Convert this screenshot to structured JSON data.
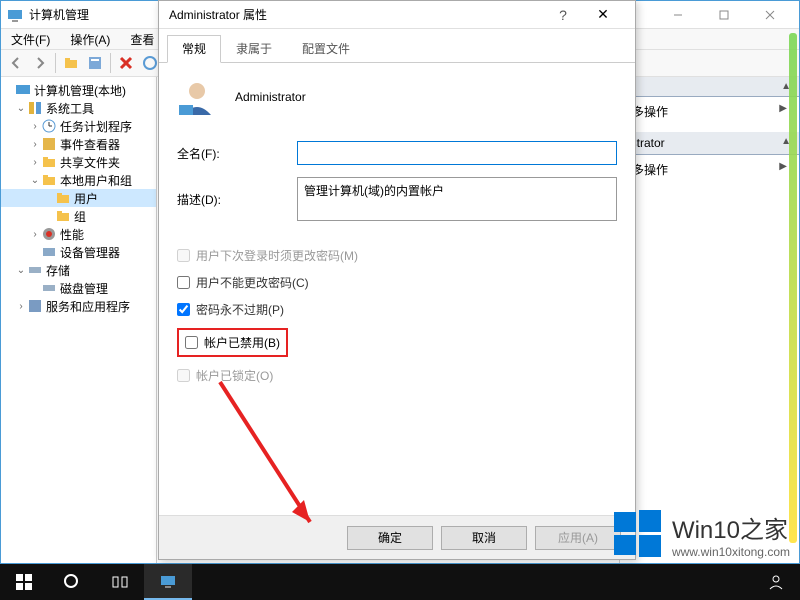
{
  "main_window": {
    "title": "计算机管理",
    "menu": {
      "file": "文件(F)",
      "action": "操作(A)",
      "view": "查看"
    },
    "tree": {
      "root": "计算机管理(本地)",
      "system_tools": "系统工具",
      "task_scheduler": "任务计划程序",
      "event_viewer": "事件查看器",
      "shared_folders": "共享文件夹",
      "local_users_groups": "本地用户和组",
      "users": "用户",
      "groups": "组",
      "performance": "性能",
      "device_manager": "设备管理器",
      "storage": "存储",
      "disk_management": "磁盘管理",
      "services_apps": "服务和应用程序"
    },
    "right_panel": {
      "more_actions_1": "多操作",
      "linked_header": "istrator",
      "more_actions_2": "多操作"
    }
  },
  "dialog": {
    "title": "Administrator 属性",
    "tabs": {
      "general": "常规",
      "member_of": "隶属于",
      "profile": "配置文件"
    },
    "user_name": "Administrator",
    "fullname_label": "全名(F):",
    "fullname_value": "",
    "description_label": "描述(D):",
    "description_value": "管理计算机(域)的内置帐户",
    "checks": {
      "must_change": "用户下次登录时须更改密码(M)",
      "cannot_change": "用户不能更改密码(C)",
      "never_expires": "密码永不过期(P)",
      "disabled": "帐户已禁用(B)",
      "locked": "帐户已锁定(O)"
    },
    "buttons": {
      "ok": "确定",
      "cancel": "取消",
      "apply": "应用(A)"
    }
  },
  "watermark": {
    "brand": "Win10之家",
    "url": "www.win10xitong.com"
  }
}
